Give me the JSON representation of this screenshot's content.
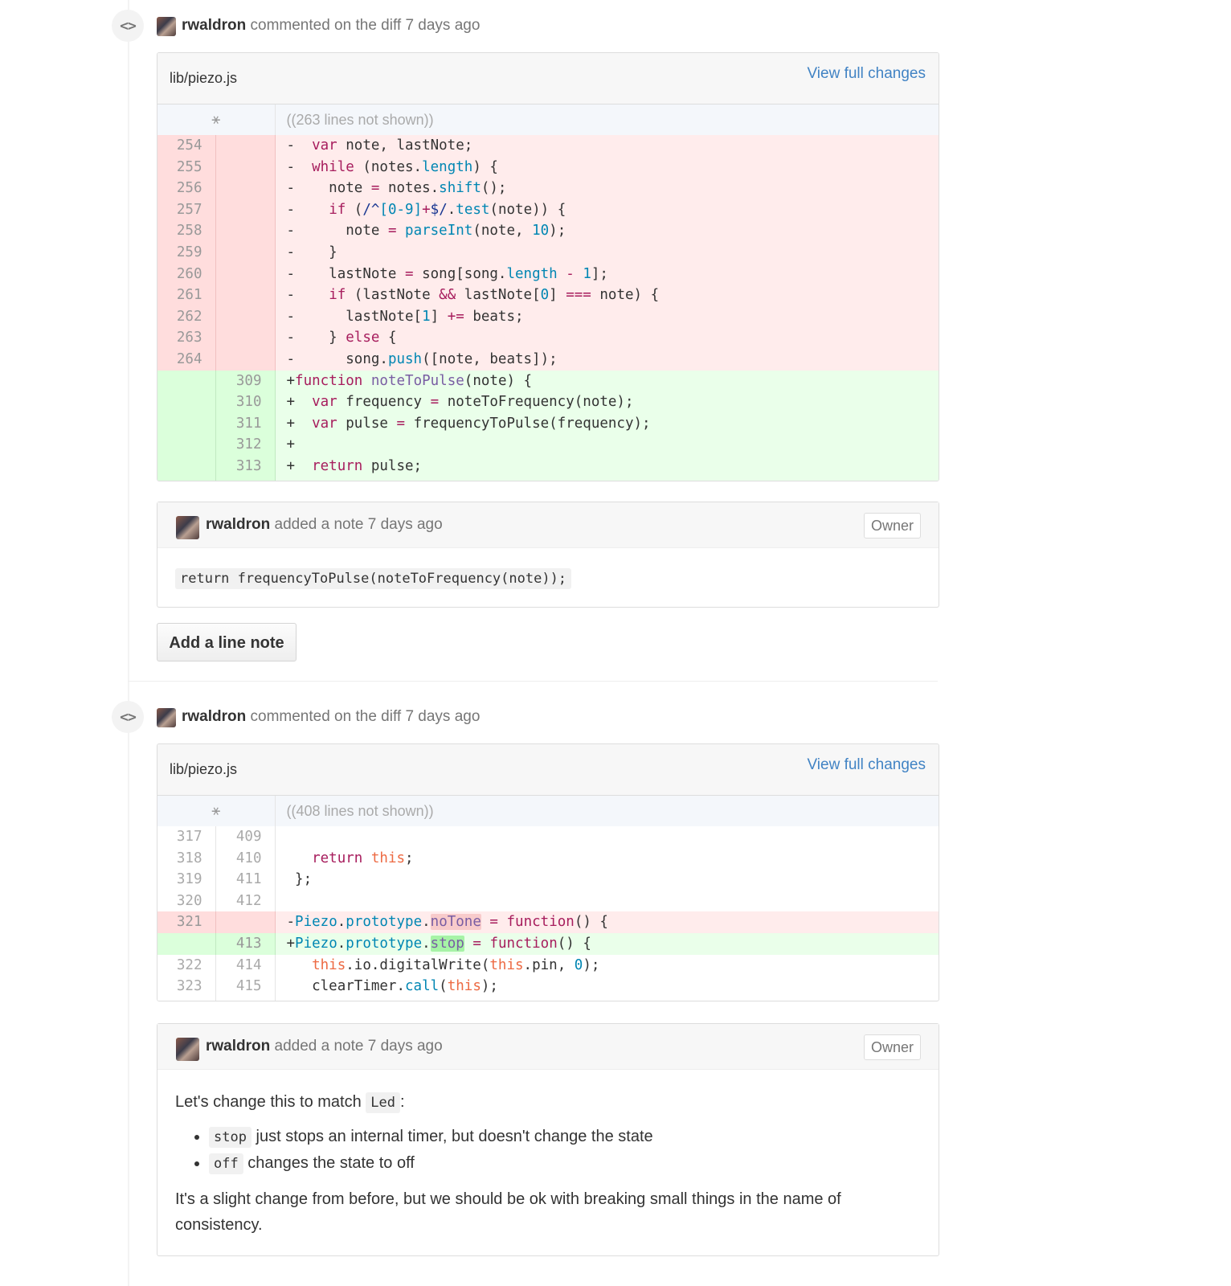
{
  "comment1": {
    "author": "rwaldron",
    "action": "commented on the diff 7 days ago",
    "file_path": "lib/piezo.js",
    "view_full": "View full changes",
    "hunk_text": "((263 lines not shown))",
    "note": {
      "author": "rwaldron",
      "action": "added a note 7 days ago",
      "badge": "Owner",
      "code": "return frequencyToPulse(noteToFrequency(note));"
    },
    "add_line_note": "Add a line note"
  },
  "comment2": {
    "author": "rwaldron",
    "action": "commented on the diff 7 days ago",
    "file_path": "lib/piezo.js",
    "view_full": "View full changes",
    "hunk_text": "((408 lines not shown))",
    "note": {
      "author": "rwaldron",
      "action": "added a note 7 days ago",
      "badge": "Owner",
      "intro_pre": "Let's change this to match",
      "intro_code": "Led",
      "intro_post": ":",
      "bullets": [
        {
          "code": "stop",
          "text": "just stops an internal timer, but doesn't change the state"
        },
        {
          "code": "off",
          "text": "changes the state to off"
        }
      ],
      "closing": "It's a slight change from before, but we should be ok with breaking small things in the name of consistency."
    }
  },
  "icons": {
    "diff": "code-icon",
    "expand": "unfold-icon"
  },
  "colors": {
    "link": "#4183c4",
    "deleted_bg": "#ffecec",
    "added_bg": "#eaffea"
  }
}
